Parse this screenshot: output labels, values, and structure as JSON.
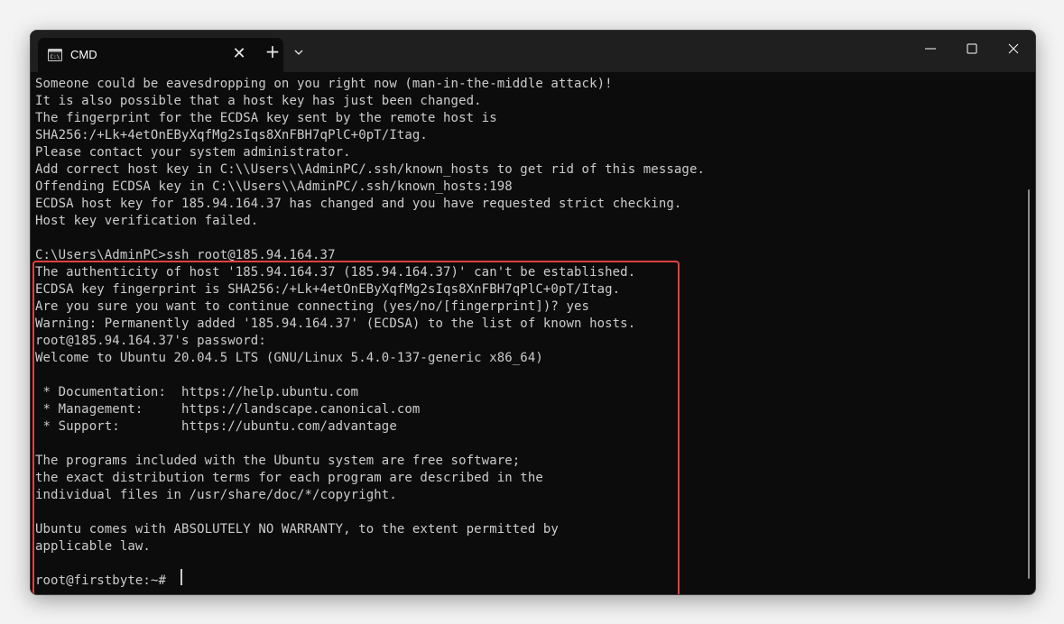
{
  "window": {
    "tab_title": "CMD",
    "tab_close_glyph": "✕",
    "new_tab_glyph": "+",
    "icons": {
      "tab_icon": "cmd-icon",
      "close": "close-icon",
      "new_tab": "plus-icon",
      "dropdown": "chevron-down-icon",
      "minimize": "minimize-icon",
      "maximize": "maximize-icon",
      "window_close": "window-close-icon"
    }
  },
  "colors": {
    "terminal_bg": "#0c0c0c",
    "terminal_text": "#cccccc",
    "titlebar_bg": "#1f1f1f",
    "highlight_border": "#e04040"
  },
  "console": {
    "lines": [
      "Someone could be eavesdropping on you right now (man-in-the-middle attack)!",
      "It is also possible that a host key has just been changed.",
      "The fingerprint for the ECDSA key sent by the remote host is",
      "SHA256:/+Lk+4etOnEByXqfMg2sIqs8XnFBH7qPlC+0pT/Itag.",
      "Please contact your system administrator.",
      "Add correct host key in C:\\\\Users\\\\AdminPC/.ssh/known_hosts to get rid of this message.",
      "Offending ECDSA key in C:\\\\Users\\\\AdminPC/.ssh/known_hosts:198",
      "ECDSA host key for 185.94.164.37 has changed and you have requested strict checking.",
      "Host key verification failed.",
      "",
      "C:\\Users\\AdminPC>ssh root@185.94.164.37",
      "The authenticity of host '185.94.164.37 (185.94.164.37)' can't be established.",
      "ECDSA key fingerprint is SHA256:/+Lk+4etOnEByXqfMg2sIqs8XnFBH7qPlC+0pT/Itag.",
      "Are you sure you want to continue connecting (yes/no/[fingerprint])? yes",
      "Warning: Permanently added '185.94.164.37' (ECDSA) to the list of known hosts.",
      "root@185.94.164.37's password:",
      "Welcome to Ubuntu 20.04.5 LTS (GNU/Linux 5.4.0-137-generic x86_64)",
      "",
      " * Documentation:  https://help.ubuntu.com",
      " * Management:     https://landscape.canonical.com",
      " * Support:        https://ubuntu.com/advantage",
      "",
      "The programs included with the Ubuntu system are free software;",
      "the exact distribution terms for each program are described in the",
      "individual files in /usr/share/doc/*/copyright.",
      "",
      "Ubuntu comes with ABSOLUTELY NO WARRANTY, to the extent permitted by",
      "applicable law.",
      "",
      "root@firstbyte:~# "
    ]
  }
}
